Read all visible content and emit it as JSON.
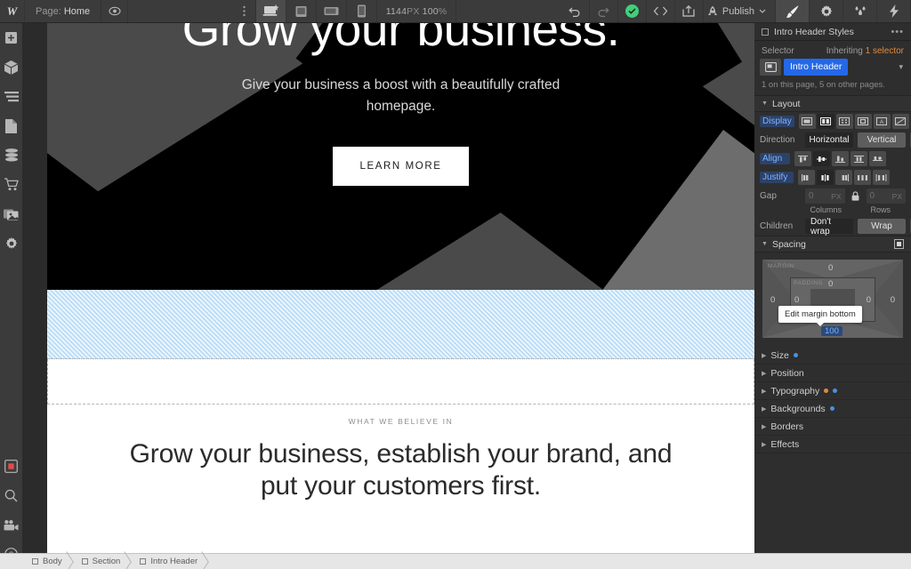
{
  "topbar": {
    "logo": "W",
    "page_label": "Page:",
    "page_name": "Home",
    "eye_icon": "preview-eye-icon",
    "dots_icon": "more-options-icon",
    "devices": [
      {
        "name": "desktop",
        "icon": "desktop-breakpoint-icon",
        "active": true
      },
      {
        "name": "tablet",
        "icon": "tablet-breakpoint-icon",
        "active": false
      },
      {
        "name": "mobile-landscape",
        "icon": "mobile-landscape-breakpoint-icon",
        "active": false
      },
      {
        "name": "mobile-portrait",
        "icon": "mobile-portrait-breakpoint-icon",
        "active": false
      }
    ],
    "canvas_width": "1144",
    "canvas_width_unit": "PX",
    "zoom_value": "100",
    "zoom_unit": "%",
    "undo_icon": "undo-icon",
    "redo_icon": "redo-icon",
    "saved_icon": "saved-check-icon",
    "code_icon": "code-icon",
    "export_icon": "export-icon",
    "publish_icon": "rocket-icon",
    "publish_label": "Publish",
    "publish_caret": "chevron-down-icon",
    "style_icon": "paintbrush-icon",
    "settings_icon": "gear-icon",
    "interactions_icon": "interactions-icon",
    "effects_icon": "lightning-icon"
  },
  "rail": {
    "items": [
      {
        "name": "add-elements",
        "icon": "plus-icon"
      },
      {
        "name": "components",
        "icon": "cube-icon"
      },
      {
        "name": "navigator",
        "icon": "layers-icon"
      },
      {
        "name": "pages",
        "icon": "page-icon"
      },
      {
        "name": "cms",
        "icon": "database-icon"
      },
      {
        "name": "ecommerce",
        "icon": "cart-icon"
      },
      {
        "name": "assets",
        "icon": "images-icon"
      },
      {
        "name": "settings",
        "icon": "gear-icon"
      }
    ],
    "bottom_items": [
      {
        "name": "video-record",
        "icon": "record-square-icon"
      },
      {
        "name": "search",
        "icon": "search-icon"
      },
      {
        "name": "video-tutorials",
        "icon": "video-camera-icon"
      },
      {
        "name": "help",
        "icon": "help-question-icon"
      }
    ]
  },
  "canvas": {
    "hero": {
      "heading": "Grow your business.",
      "subheading": "Give your business a boost with a beautifully crafted homepage.",
      "button_label": "LEARN MORE"
    },
    "believe": {
      "eyebrow": "WHAT WE BELIEVE IN",
      "heading": "Grow your business, establish your brand, and put your customers first."
    }
  },
  "panel": {
    "title": "Intro Header Styles",
    "title_icon": "element-square-icon",
    "menu_icon": "more-dots-icon",
    "selector_label": "Selector",
    "inheriting_text": "Inheriting",
    "inheriting_count": "1 selector",
    "class_icon": "class-image-icon",
    "class_tag": "Intro Header",
    "class_caret": "chevron-down-icon",
    "usage_note": "1 on this page, 5 on other pages.",
    "layout": {
      "section_title": "Layout",
      "display_label": "Display",
      "display_options": [
        {
          "name": "display-block",
          "icon": "block-icon",
          "active": false
        },
        {
          "name": "display-flex",
          "icon": "flex-icon",
          "active": true
        },
        {
          "name": "display-grid",
          "icon": "grid-icon",
          "active": false
        },
        {
          "name": "display-inline-block",
          "icon": "inline-block-icon",
          "active": false
        },
        {
          "name": "display-inline",
          "icon": "inline-text-icon",
          "active": false
        },
        {
          "name": "display-none",
          "icon": "none-icon",
          "active": false
        }
      ],
      "direction_label": "Direction",
      "direction_horizontal": "Horizontal",
      "direction_vertical": "Vertical",
      "direction_active": "Horizontal",
      "direction_reverse_icon": "reverse-direction-icon",
      "align_label": "Align",
      "align_active_index": 1,
      "justify_label": "Justify",
      "justify_active_index": 1,
      "gap_label": "Gap",
      "gap_columns_value": "0",
      "gap_rows_value": "0",
      "gap_unit": "PX",
      "gap_lock_icon": "lock-icon",
      "columns_label": "Columns",
      "rows_label": "Rows",
      "children_label": "Children",
      "children_nowrap": "Don't wrap",
      "children_wrap": "Wrap",
      "children_active": "Don't wrap",
      "children_reverse_icon": "reverse-wrap-icon"
    },
    "spacing": {
      "section_title": "Spacing",
      "section_icon": "spacing-mode-icon",
      "margin_label": "MARGIN",
      "padding_label": "PADDING",
      "margin_top": "0",
      "margin_right": "0",
      "margin_bottom": "100",
      "margin_left": "0",
      "padding_top": "0",
      "padding_right": "0",
      "padding_bottom": "0",
      "padding_left": "0",
      "tooltip": "Edit margin bottom"
    },
    "sections": [
      {
        "label": "Size",
        "dots": [
          "blue"
        ]
      },
      {
        "label": "Position",
        "dots": []
      },
      {
        "label": "Typography",
        "dots": [
          "orange",
          "blue"
        ]
      },
      {
        "label": "Backgrounds",
        "dots": [
          "blue"
        ]
      },
      {
        "label": "Borders",
        "dots": []
      },
      {
        "label": "Effects",
        "dots": []
      }
    ]
  },
  "breadcrumb": {
    "items": [
      {
        "label": "Body",
        "icon": "element-box-icon"
      },
      {
        "label": "Section",
        "icon": "element-box-icon"
      },
      {
        "label": "Intro Header",
        "icon": "element-box-icon"
      }
    ]
  },
  "colors": {
    "accent_blue": "#2468e8",
    "saved_green": "#41d07a",
    "inherit_orange": "#e08a3c",
    "margin_highlight": "#b9dcf7"
  }
}
